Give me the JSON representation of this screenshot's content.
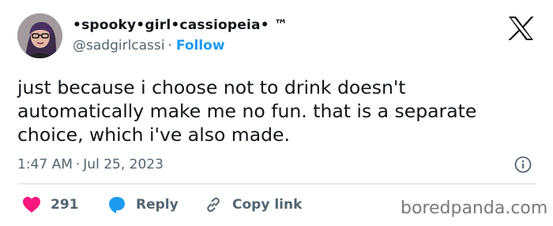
{
  "user": {
    "display_name": "•spooky•girl•cassiopeia• ™",
    "handle": "@sadgirlcassi",
    "separator": "·",
    "follow_label": "Follow"
  },
  "tweet": {
    "text": "just because i choose not to drink doesn't\nautomatically make me no fun. that is a separate\nchoice, which i've also made.",
    "time": "1:47 AM",
    "dot": "·",
    "date": "Jul 25, 2023"
  },
  "actions": {
    "likes_count": "291",
    "reply_label": "Reply",
    "copy_link_label": "Copy link"
  },
  "watermark": "boredpanda.com",
  "icons": {
    "brand": "x-logo-icon",
    "info": "info-icon",
    "like": "heart-icon",
    "reply": "reply-bubble-icon",
    "copy": "link-icon"
  },
  "colors": {
    "link_blue": "#1d9bf0",
    "heart_pink": "#f91880",
    "secondary_text": "#536471"
  }
}
